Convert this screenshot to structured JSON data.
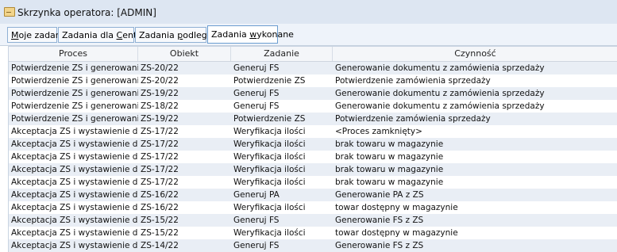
{
  "window": {
    "title": "Skrzynka operatora: [ADMIN]",
    "icon": "inbox-icon"
  },
  "tabs": [
    {
      "pre": "",
      "u": "M",
      "post": "oje zadania",
      "active": false
    },
    {
      "pre": "Zadania dla ",
      "u": "C",
      "post": "entrum",
      "active": false
    },
    {
      "pre": "Zadania ",
      "u": "p",
      "post": "odległych",
      "active": false
    },
    {
      "pre": "Zadania ",
      "u": "w",
      "post": "ykonane",
      "active": true
    }
  ],
  "table": {
    "columns": [
      "Proces",
      "Obiekt",
      "Zadanie",
      "Czynność"
    ],
    "rows": [
      [
        "Potwierdzenie ZS i generowanie FS",
        "ZS-20/22",
        "Generuj FS",
        "Generowanie dokumentu z zamówienia sprzedaży"
      ],
      [
        "Potwierdzenie ZS i generowanie FS",
        "ZS-20/22",
        "Potwierdzenie ZS",
        "Potwierdzenie zamówienia sprzedaży"
      ],
      [
        "Potwierdzenie ZS i generowanie FS",
        "ZS-19/22",
        "Generuj FS",
        "Generowanie dokumentu z zamówienia sprzedaży"
      ],
      [
        "Potwierdzenie ZS i generowanie FS",
        "ZS-18/22",
        "Generuj FS",
        "Generowanie dokumentu z zamówienia sprzedaży"
      ],
      [
        "Potwierdzenie ZS i generowanie FS",
        "ZS-19/22",
        "Potwierdzenie ZS",
        "Potwierdzenie zamówienia sprzedaży"
      ],
      [
        "Akceptacja ZS i wystawienie dokumen",
        "ZS-17/22",
        "Weryfikacja ilości",
        "<Proces zamknięty>"
      ],
      [
        "Akceptacja ZS i wystawienie dokumen",
        "ZS-17/22",
        "Weryfikacja ilości",
        "brak towaru w magazynie"
      ],
      [
        "Akceptacja ZS i wystawienie dokumen",
        "ZS-17/22",
        "Weryfikacja ilości",
        "brak towaru w magazynie"
      ],
      [
        "Akceptacja ZS i wystawienie dokumen",
        "ZS-17/22",
        "Weryfikacja ilości",
        "brak towaru w magazynie"
      ],
      [
        "Akceptacja ZS i wystawienie dokumen",
        "ZS-17/22",
        "Weryfikacja ilości",
        "brak towaru w magazynie"
      ],
      [
        "Akceptacja ZS i wystawienie dokumen",
        "ZS-16/22",
        "Generuj PA",
        "Generowanie PA z ZS"
      ],
      [
        "Akceptacja ZS i wystawienie dokumen",
        "ZS-16/22",
        "Weryfikacja ilości",
        "towar dostępny w magazynie"
      ],
      [
        "Akceptacja ZS i wystawienie dokumen",
        "ZS-15/22",
        "Generuj FS",
        "Generowanie FS z ZS"
      ],
      [
        "Akceptacja ZS i wystawienie dokumen",
        "ZS-15/22",
        "Weryfikacja ilości",
        "towar dostępny w magazynie"
      ],
      [
        "Akceptacja ZS i wystawienie dokumen",
        "ZS-14/22",
        "Generuj FS",
        "Generowanie FS z ZS"
      ]
    ]
  },
  "colors": {
    "titlebar": "#dde6f2",
    "row_alt": "#e9eef5",
    "tab_border": "#8fb0d4"
  }
}
